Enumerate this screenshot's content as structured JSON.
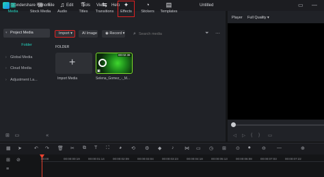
{
  "app": {
    "name": "Wondershare Filmora",
    "document_title": "Untitled"
  },
  "menu": [
    "File",
    "Edit",
    "Tools",
    "View",
    "Help"
  ],
  "toolbar_tabs": [
    {
      "label": "Media",
      "icon": "media-icon"
    },
    {
      "label": "Stock Media",
      "icon": "stock-media-icon"
    },
    {
      "label": "Audio",
      "icon": "audio-icon"
    },
    {
      "label": "Titles",
      "icon": "titles-icon"
    },
    {
      "label": "Transitions",
      "icon": "transitions-icon"
    },
    {
      "label": "Effects",
      "icon": "effects-icon"
    },
    {
      "label": "Stickers",
      "icon": "stickers-icon"
    },
    {
      "label": "Templates",
      "icon": "templates-icon"
    }
  ],
  "sidebar": {
    "items": [
      "Project Media",
      "Folder",
      "Global Media",
      "Cloud Media",
      "Adjustment La..."
    ]
  },
  "media_toolbar": {
    "import_label": "Import",
    "ai_image_label": "AI Image",
    "record_label": "Record",
    "search_placeholder": "Search media"
  },
  "media": {
    "folder_heading": "FOLDER",
    "import_label": "Import Media",
    "clip": {
      "label": "Selena_Gomez_-_M...",
      "duration": "00:02:38"
    }
  },
  "player": {
    "label": "Player",
    "quality": "Full Quality"
  },
  "timeline": {
    "ticks": [
      "00:00",
      "00:00:00:19",
      "00:00:01:14",
      "00:00:02:09",
      "00:00:03:04",
      "00:00:03:23",
      "00:00:04:18",
      "00:00:05:13",
      "00:00:06:08",
      "00:00:07:03",
      "00:00:07:22"
    ]
  },
  "colors": {
    "accent": "#23d6c0",
    "highlight_border": "#e02020",
    "playhead": "#e8412e"
  }
}
